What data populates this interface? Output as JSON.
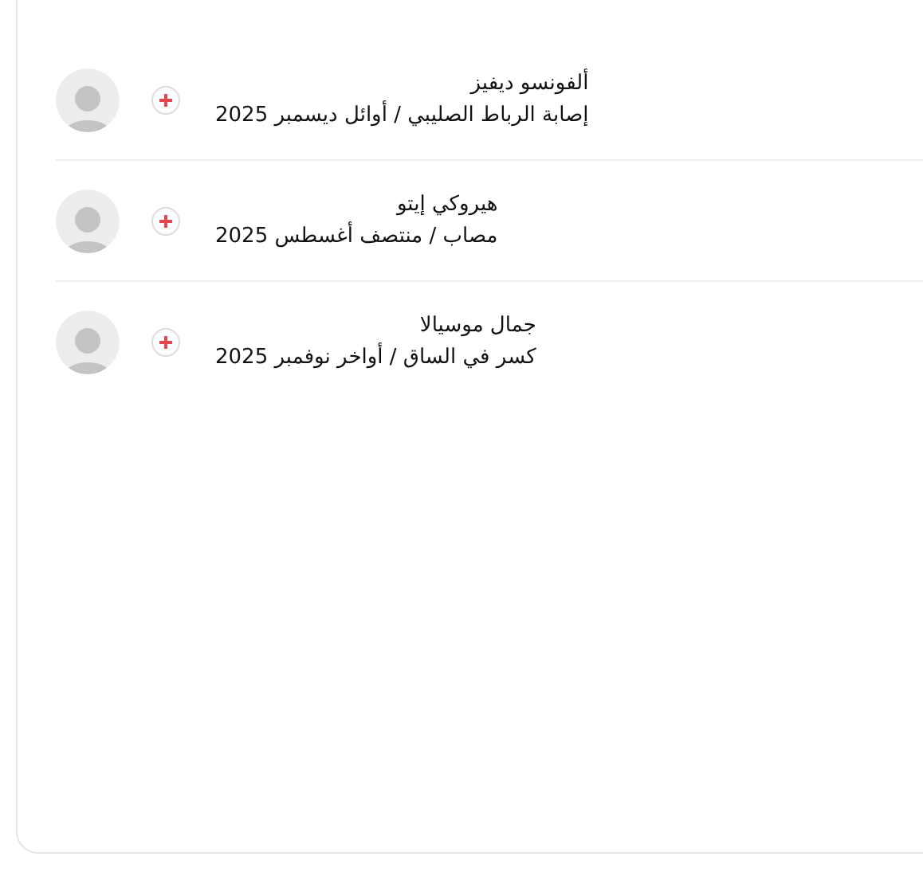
{
  "injuries": [
    {
      "name": "ألفونسو ديفيز",
      "detail": "إصابة الرباط الصليبي / أوائل ديسمبر 2025"
    },
    {
      "name": "هيروكي إيتو",
      "detail": "مصاب / منتصف أغسطس 2025"
    },
    {
      "name": "جمال موسيالا",
      "detail": "كسر في الساق / أواخر نوفمبر 2025"
    }
  ]
}
